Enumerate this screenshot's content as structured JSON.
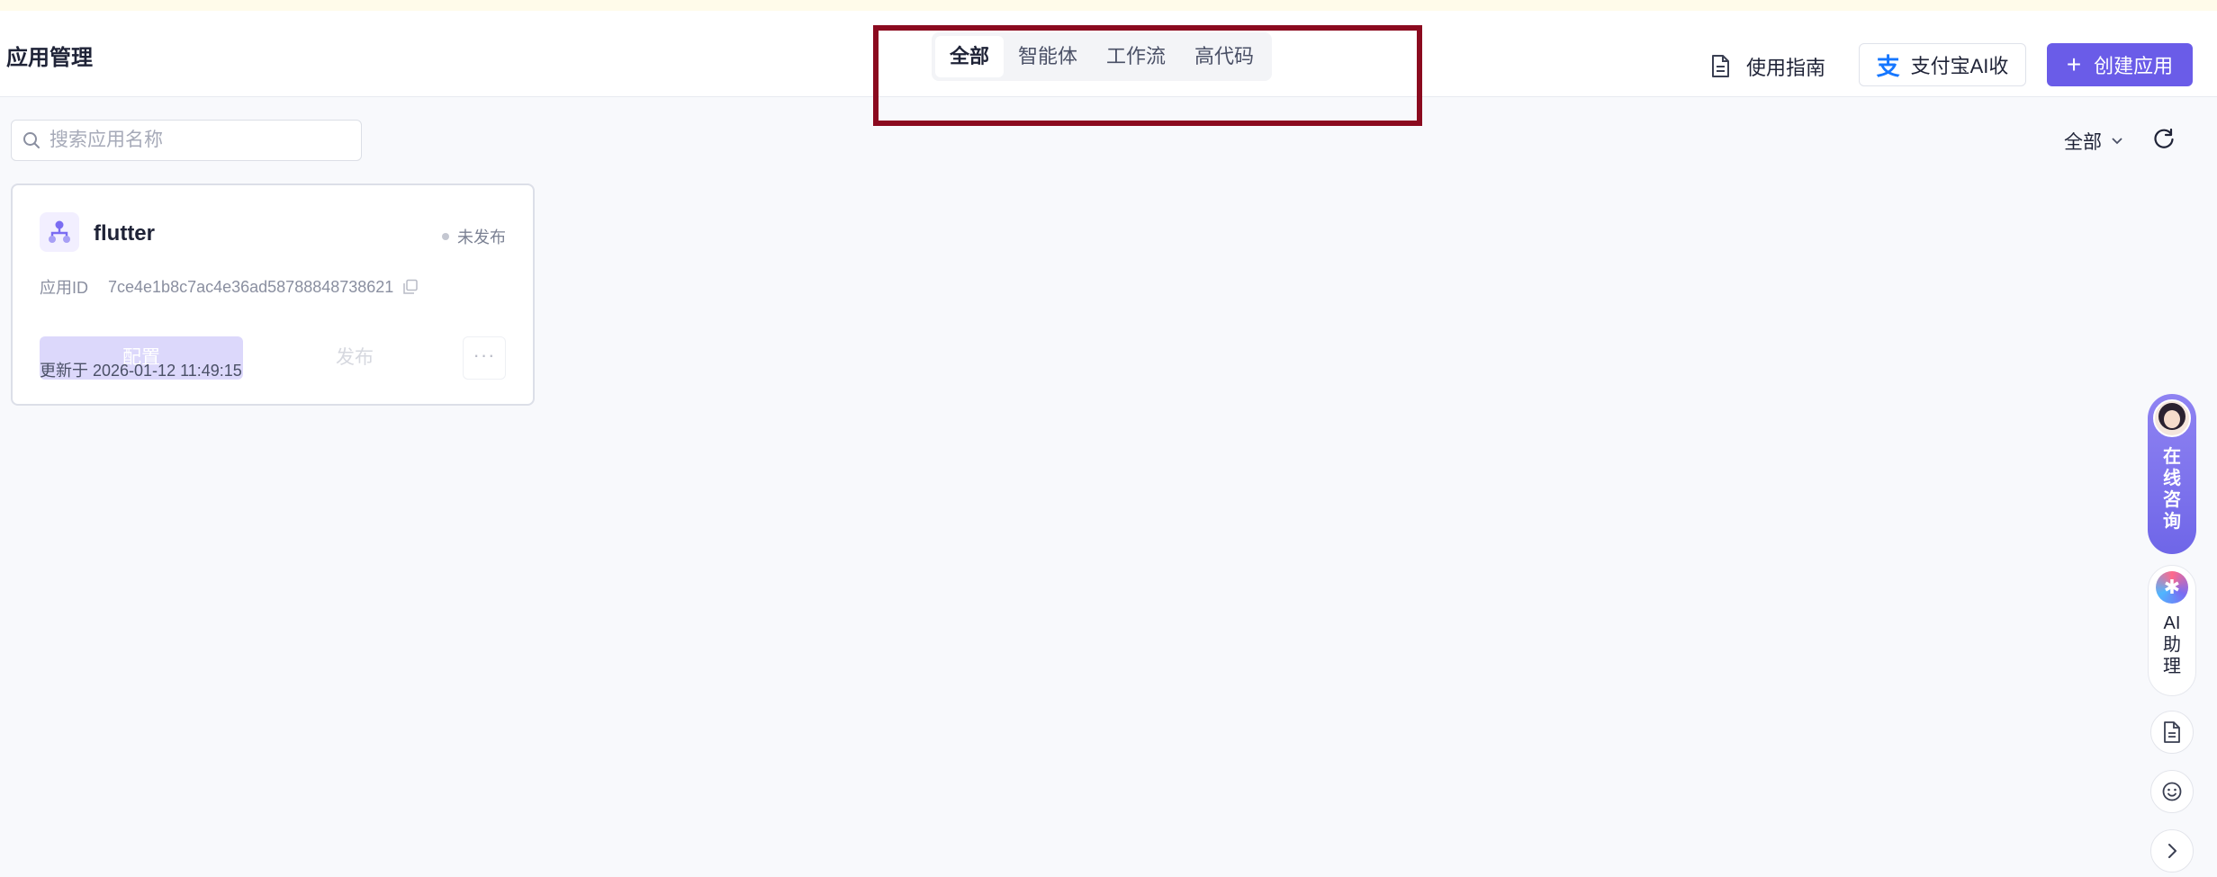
{
  "header": {
    "title": "应用管理",
    "tabs": [
      {
        "label": "全部",
        "active": true
      },
      {
        "label": "智能体",
        "active": false
      },
      {
        "label": "工作流",
        "active": false
      },
      {
        "label": "高代码",
        "active": false
      }
    ],
    "guide_label": "使用指南",
    "alipay_label": "支付宝AI收",
    "create_label": "创建应用"
  },
  "toolbar": {
    "search_placeholder": "搜索应用名称",
    "filter_label": "全部"
  },
  "cards": [
    {
      "name": "flutter",
      "status": "未发布",
      "id_label": "应用ID",
      "id_value": "7ce4e1b8c7ac4e36ad58788848738621",
      "config_label": "配置",
      "publish_label": "发布",
      "more_label": "···",
      "updated": "更新于 2026-01-12 11:49:15"
    }
  ],
  "side": {
    "consult_label": "在线咨询",
    "ai_label": "AI助理"
  },
  "colors": {
    "accent": "#6a5ce8",
    "highlight": "#8b0a1f",
    "alipay": "#1677ff"
  }
}
